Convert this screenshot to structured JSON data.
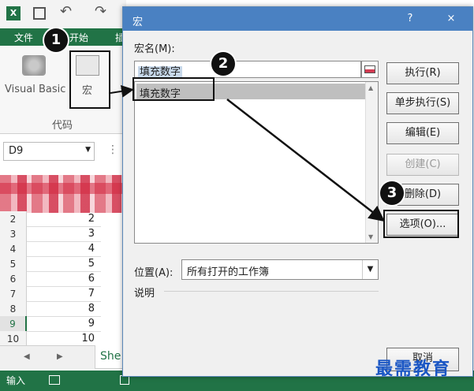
{
  "excel": {
    "tabs": [
      "文件",
      "开始",
      "插"
    ],
    "ribbon_visual_basic": "Visual Basic",
    "ribbon_macro": "宏",
    "ribbon_group": "代码",
    "name_box": "D9",
    "rows": [
      {
        "h": "2",
        "v": "2"
      },
      {
        "h": "3",
        "v": "3"
      },
      {
        "h": "4",
        "v": "4"
      },
      {
        "h": "5",
        "v": "5"
      },
      {
        "h": "6",
        "v": "6"
      },
      {
        "h": "7",
        "v": "7"
      },
      {
        "h": "8",
        "v": "8"
      },
      {
        "h": "9",
        "v": "9"
      },
      {
        "h": "10",
        "v": "10"
      }
    ],
    "sheet_tab": "She",
    "status": "输入"
  },
  "dialog": {
    "title": "宏",
    "help": "?",
    "close": "×",
    "name_label": "宏名(M):",
    "name_value": "填充数字",
    "list_items": [
      "填充数字"
    ],
    "location_label": "位置(A):",
    "location_value": "所有打开的工作簿",
    "description_label": "说明",
    "buttons": {
      "run": "执行(R)",
      "step_into": "单步执行(S)",
      "edit": "编辑(E)",
      "create": "创建(C)",
      "delete": "删除(D)",
      "options": "选项(O)...",
      "cancel": "取消"
    }
  },
  "annotations": {
    "m1": "1",
    "m2": "2",
    "m3": "3"
  },
  "watermark": "最需教育",
  "colors": {
    "excel_green": "#217346",
    "title_blue": "#4a81c2",
    "watermark_blue": "#1a56c4"
  }
}
